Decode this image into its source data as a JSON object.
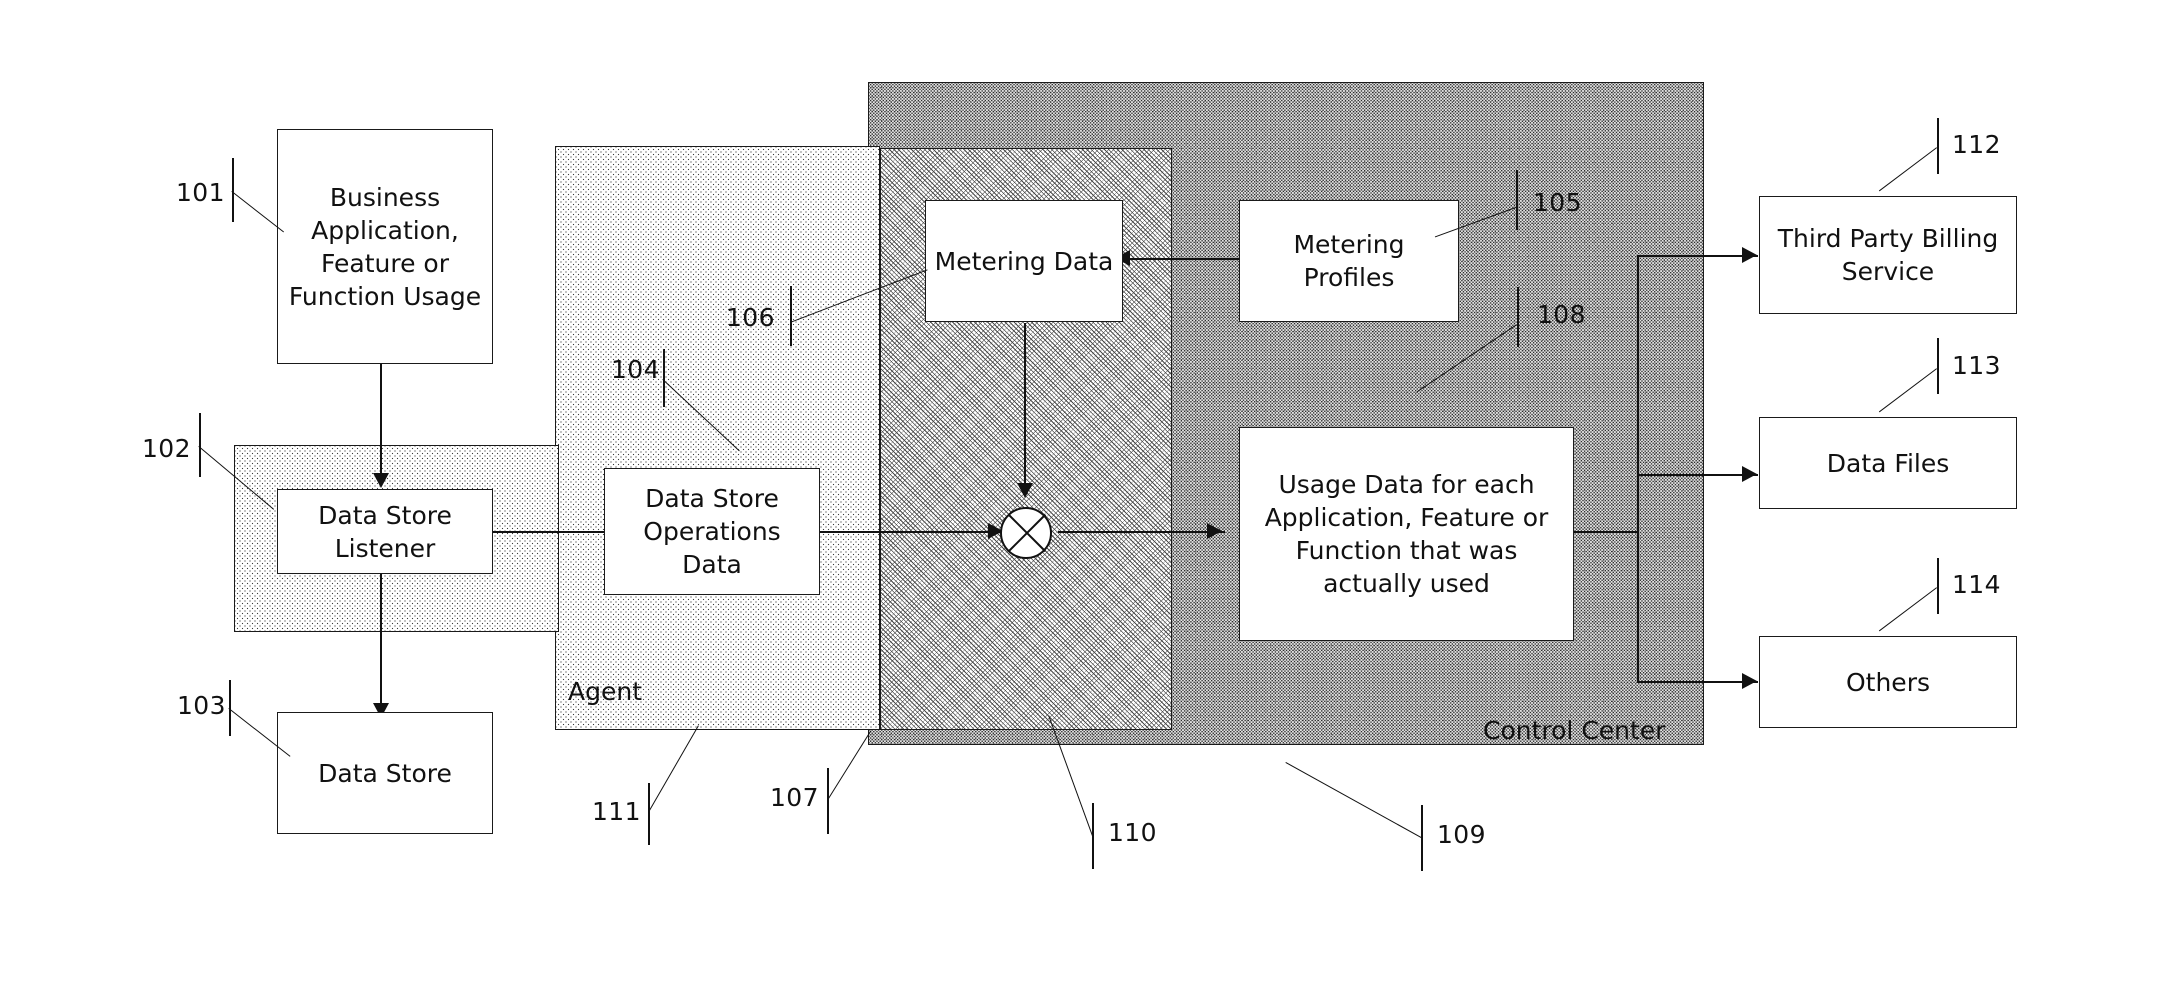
{
  "diagram": {
    "title": "Metering and usage-data collection block diagram",
    "regions": [
      {
        "id": "102",
        "label": "",
        "numeral": "102"
      },
      {
        "id": "111",
        "label": "Agent",
        "numeral": "111"
      },
      {
        "id": "107",
        "label": "",
        "numeral": "107"
      },
      {
        "id": "109",
        "label": "Control Center",
        "numeral": "109"
      }
    ],
    "nodes": [
      {
        "key": "business_application",
        "label": "Business Application, Feature or Function Usage",
        "numeral": "101"
      },
      {
        "key": "data_store_listener",
        "label": "Data Store Listener",
        "numeral": "102"
      },
      {
        "key": "data_store",
        "label": "Data Store",
        "numeral": "103"
      },
      {
        "key": "data_store_operations_data",
        "label": "Data Store Operations Data",
        "numeral": "104"
      },
      {
        "key": "metering_profiles",
        "label": "Metering Profiles",
        "numeral": "105"
      },
      {
        "key": "metering_data",
        "label": "Metering Data",
        "numeral": "106"
      },
      {
        "key": "usage_data",
        "label": "Usage Data for each Application, Feature or Function that was actually used",
        "numeral": "108"
      },
      {
        "key": "third_party_billing",
        "label": "Third Party Billing Service",
        "numeral": "112"
      },
      {
        "key": "data_files",
        "label": "Data Files",
        "numeral": "113"
      },
      {
        "key": "others",
        "label": "Others",
        "numeral": "114"
      }
    ],
    "operator": {
      "key": "combiner",
      "symbol": "crossed-circle",
      "numeral": "110"
    },
    "numerals": {
      "n101": "101",
      "n102": "102",
      "n103": "103",
      "n104": "104",
      "n105": "105",
      "n106": "106",
      "n107": "107",
      "n108": "108",
      "n109": "109",
      "n110": "110",
      "n111": "111",
      "n112": "112",
      "n113": "113",
      "n114": "114"
    },
    "captions": {
      "agent": "Agent",
      "control_center": "Control Center"
    },
    "labels": {
      "business_application": "Business Application, Feature or Function Usage",
      "data_store_listener": "Data Store Listener",
      "data_store": "Data Store",
      "data_store_operations_data": "Data Store Operations Data",
      "metering_profiles": "Metering Profiles",
      "metering_data": "Metering Data",
      "usage_data": "Usage Data for each Application, Feature or Function that was actually used",
      "third_party_billing": "Third Party Billing Service",
      "data_files": "Data Files",
      "others": "Others"
    },
    "colors": {
      "ink": "#111111",
      "paper": "#ffffff",
      "region_fill": "#e3e3e3"
    }
  }
}
